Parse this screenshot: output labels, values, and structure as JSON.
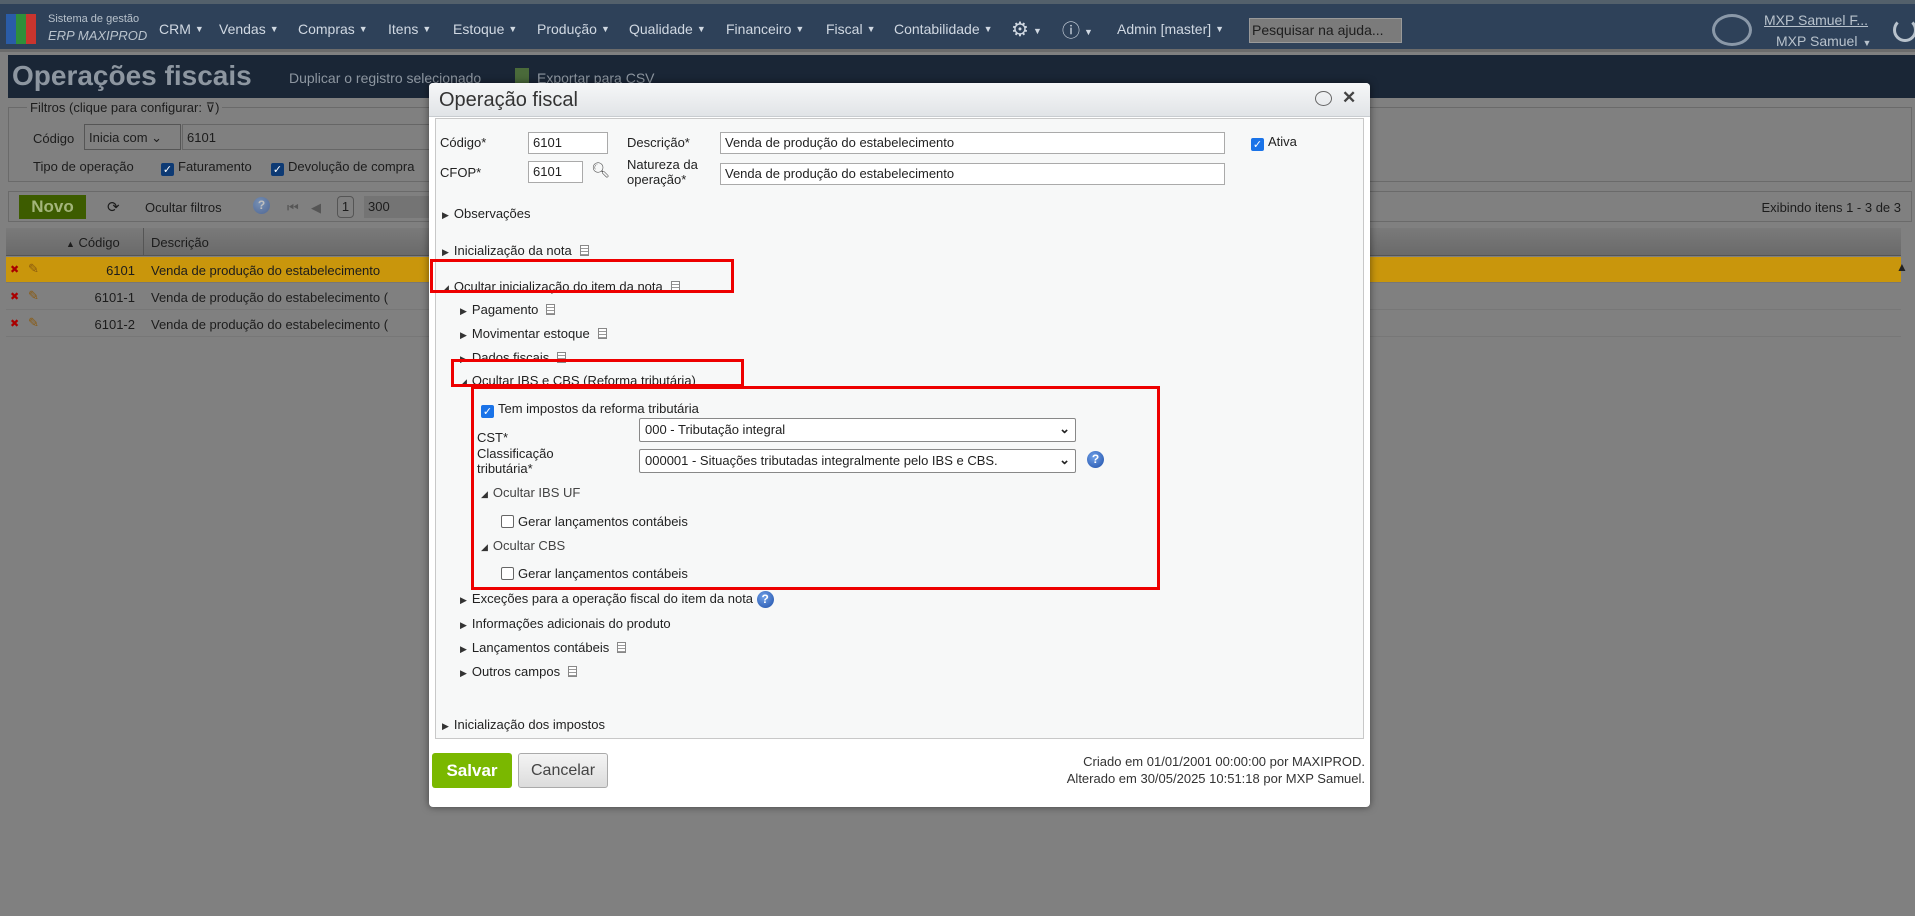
{
  "nav": {
    "logo_line1": "Sistema de gestão",
    "logo_line2": "ERP MAXIPROD",
    "menus": [
      "CRM",
      "Vendas",
      "Compras",
      "Itens",
      "Estoque",
      "Produção",
      "Qualidade",
      "Financeiro",
      "Fiscal",
      "Contabilidade"
    ],
    "admin": "Admin [master]",
    "search_placeholder": "Pesquisar na ajuda...",
    "user_link": "MXP Samuel F...",
    "user_name": "MXP Samuel"
  },
  "page": {
    "title": "Operações fiscais",
    "duplicate": "Duplicar o registro selecionado",
    "export": "Exportar para CSV",
    "filters": {
      "legend": "Filtros (clique para configurar:",
      "code_label": "Código",
      "code_mode": "Inicia com",
      "code_value": "6101",
      "type_label": "Tipo de operação",
      "types": [
        {
          "label": "Faturamento",
          "checked": true
        },
        {
          "label": "Devolução de compra",
          "checked": true
        }
      ]
    },
    "toolbar": {
      "new": "Novo",
      "hide_filters": "Ocultar filtros",
      "page": "1",
      "page_size": "300",
      "showing": "Exibindo itens 1 - 3 de 3"
    },
    "grid": {
      "columns": [
        "Código",
        "Descrição"
      ],
      "rows": [
        {
          "code": "6101",
          "desc": "Venda de produção do estabelecimento",
          "selected": true
        },
        {
          "code": "6101-1",
          "desc": "Venda de produção do estabelecimento (",
          "selected": false
        },
        {
          "code": "6101-2",
          "desc": "Venda de produção do estabelecimento (",
          "selected": false
        }
      ]
    }
  },
  "modal": {
    "title": "Operação fiscal",
    "codigo_label": "Código*",
    "codigo": "6101",
    "descricao_label": "Descrição*",
    "descricao": "Venda de produção do estabelecimento",
    "ativa_label": "Ativa",
    "ativa": true,
    "cfop_label": "CFOP*",
    "cfop": "6101",
    "natureza_label_1": "Natureza da",
    "natureza_label_2": "operação*",
    "natureza": "Venda de produção do estabelecimento",
    "observacoes": "Observações",
    "init_nota": "Inicialização da nota",
    "hide_init_item": "Ocultar inicialização do item da nota",
    "pagamento": "Pagamento",
    "movimentar": "Movimentar estoque",
    "dados_fiscais": "Dados fiscais",
    "hide_ibs_cbs": "Ocultar IBS e CBS (Reforma tributária)",
    "tem_impostos": "Tem impostos da reforma tributária",
    "tem_impostos_checked": true,
    "cst_label": "CST*",
    "cst": "000 - Tributação integral",
    "class_label_1": "Classificação",
    "class_label_2": "tributária*",
    "class": "000001 - Situações tributadas integralmente pelo IBS e CBS.",
    "hide_ibs_uf": "Ocultar IBS UF",
    "gerar1": "Gerar lançamentos contábeis",
    "gerar1_checked": false,
    "hide_cbs": "Ocultar CBS",
    "gerar2": "Gerar lançamentos contábeis",
    "gerar2_checked": false,
    "excecoes": "Exceções para a operação fiscal do item da nota",
    "info_adic": "Informações adicionais do produto",
    "lancamentos": "Lançamentos contábeis",
    "outros": "Outros campos",
    "init_impostos": "Inicialização dos impostos",
    "save": "Salvar",
    "cancel": "Cancelar",
    "created": "Criado em 01/01/2001 00:00:00 por MAXIPROD.",
    "altered": "Alterado em 30/05/2025 10:51:18 por MXP Samuel."
  },
  "colors": {
    "nav": "#2e4159",
    "save": "#7ab800",
    "highlight": "#e00000",
    "selected_row": "#c9960c"
  }
}
